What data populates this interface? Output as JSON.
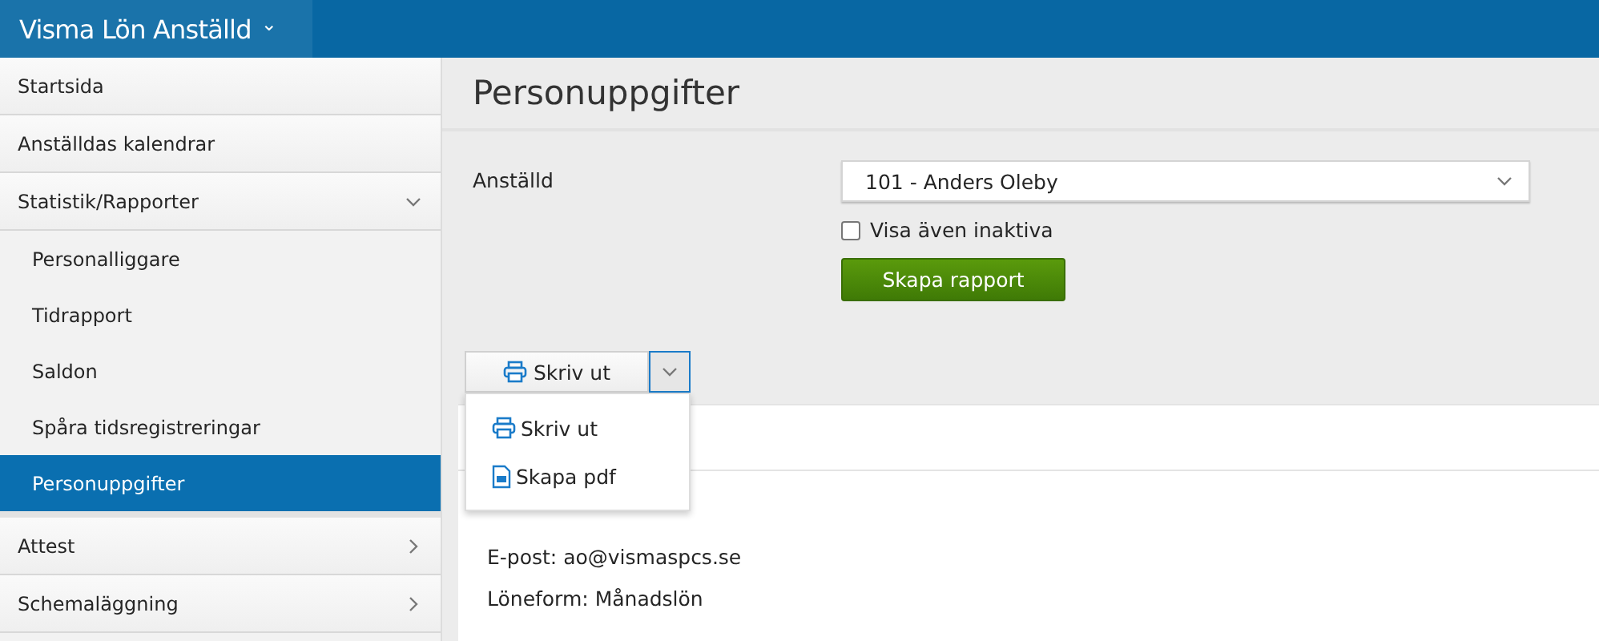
{
  "app": {
    "title": "Visma Lön Anställd",
    "caret": "⌄"
  },
  "sidebar": {
    "items": [
      {
        "label": "Startsida"
      },
      {
        "label": "Anställdas kalendrar"
      },
      {
        "label": "Statistik/Rapporter",
        "expanded": true,
        "children": [
          {
            "label": "Personalliggare",
            "selected": false
          },
          {
            "label": "Tidrapport",
            "selected": false
          },
          {
            "label": "Saldon",
            "selected": false
          },
          {
            "label": "Spåra tidsregistreringar",
            "selected": false
          },
          {
            "label": "Personuppgifter",
            "selected": true
          }
        ]
      },
      {
        "label": "Attest",
        "expanded": false
      },
      {
        "label": "Schemaläggning",
        "expanded": false
      }
    ]
  },
  "page": {
    "title": "Personuppgifter",
    "form": {
      "employee_label": "Anställd",
      "employee_value": "101 - Anders Oleby",
      "show_inactive": {
        "label": "Visa även inaktiva",
        "checked": false
      },
      "submit": "Skapa rapport"
    },
    "print_button": {
      "label": "Skriv ut",
      "menu_open": true
    },
    "print_menu": [
      {
        "kind": "print",
        "label": "Skriv ut"
      },
      {
        "kind": "pdf",
        "label": "Skapa pdf"
      }
    ],
    "details": [
      "E-post: ao@vismaspcs.se",
      "Löneform: Månadslön"
    ]
  }
}
